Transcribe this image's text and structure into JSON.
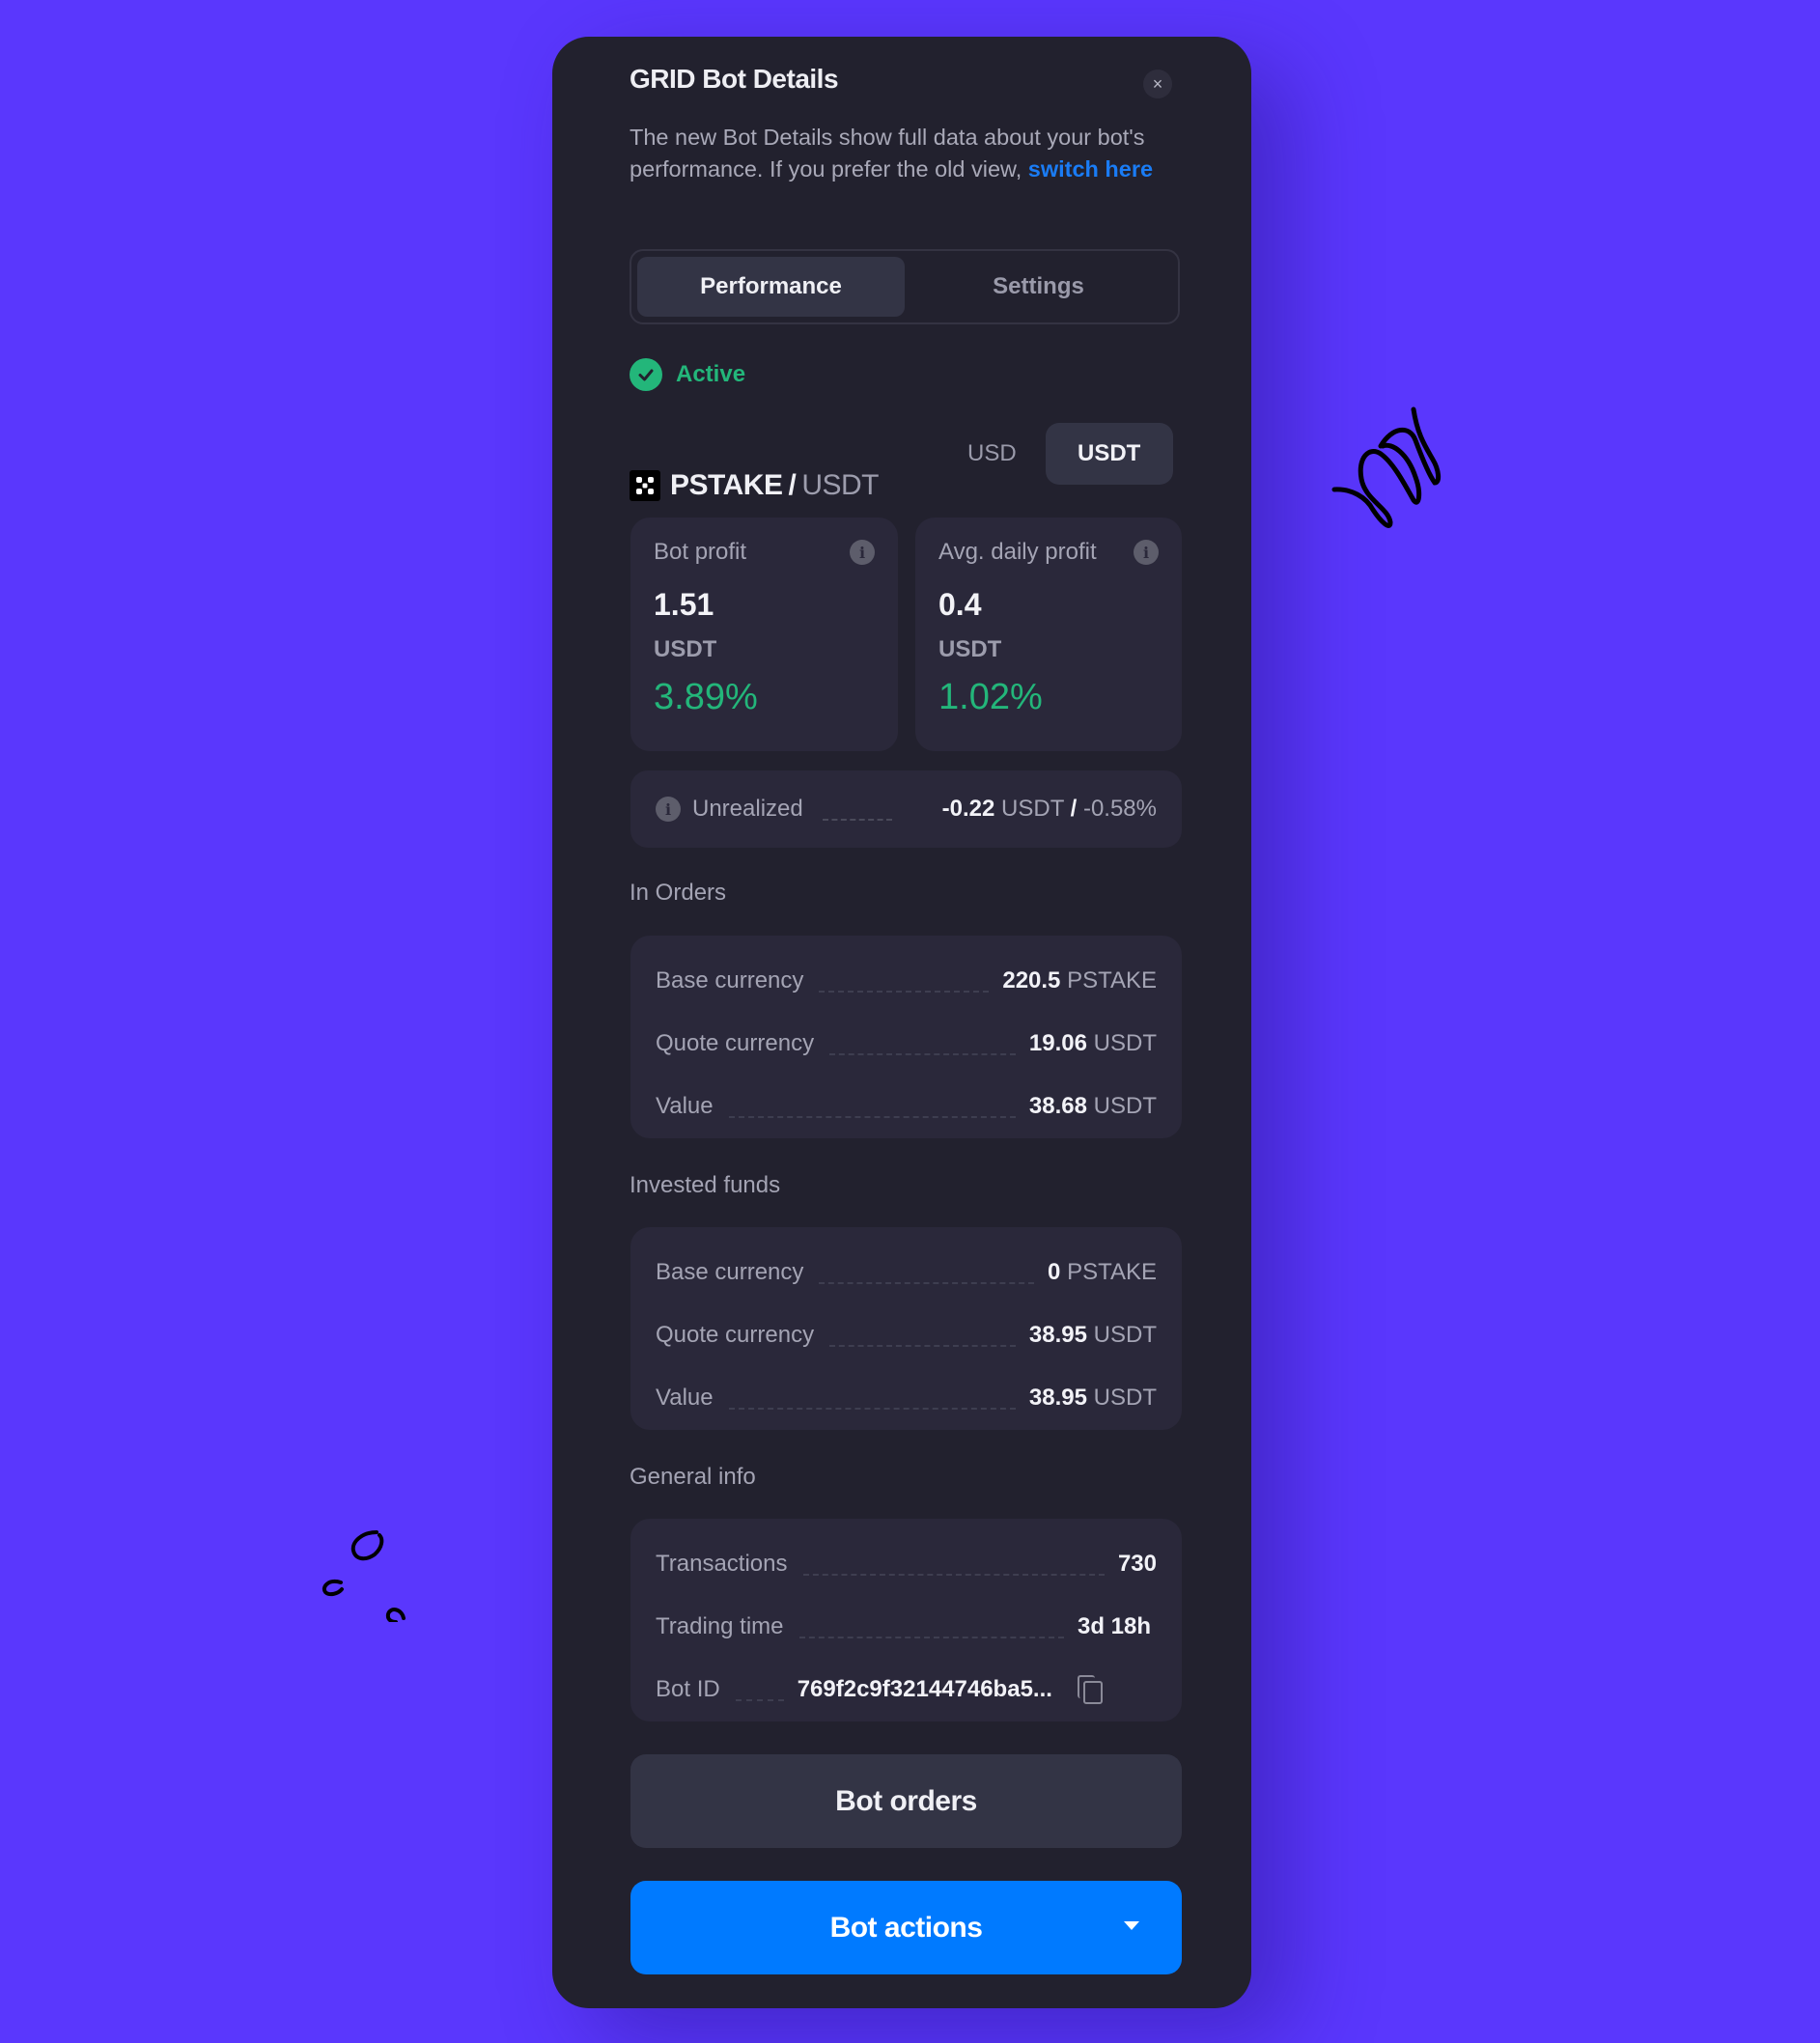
{
  "colors": {
    "background": "#5a37fd",
    "panel": "#22212e",
    "accent_green": "#23b67a",
    "link_blue": "#1a7cf5",
    "primary_button": "#007aff"
  },
  "dialog": {
    "title": "GRID Bot Details",
    "close_icon": "close-icon",
    "description": "The new Bot Details show full data about your bot's performance. If you prefer the old view, ",
    "switch_link": "switch here"
  },
  "tabs": [
    {
      "label": "Performance",
      "active": true
    },
    {
      "label": "Settings",
      "active": false
    }
  ],
  "status": {
    "label": "Active",
    "icon": "check-circle-icon"
  },
  "pair": {
    "base": "PSTAKE",
    "separator": "/",
    "quote": "USDT",
    "icon": "pstake-logo-icon"
  },
  "currency_toggle": [
    {
      "label": "USD",
      "active": false
    },
    {
      "label": "USDT",
      "active": true
    }
  ],
  "stats": {
    "bot_profit": {
      "label": "Bot profit",
      "value": "1.51",
      "unit": "USDT",
      "percent": "3.89%"
    },
    "avg_daily_profit": {
      "label": "Avg. daily profit",
      "value": "0.4",
      "unit": "USDT",
      "percent": "1.02%"
    }
  },
  "unrealized": {
    "label": "Unrealized",
    "value": "-0.22",
    "unit": "USDT",
    "separator": "/",
    "percent": "-0.58%"
  },
  "in_orders": {
    "title": "In Orders",
    "rows": [
      {
        "label": "Base currency",
        "value": "220.5",
        "unit": "PSTAKE"
      },
      {
        "label": "Quote currency",
        "value": "19.06",
        "unit": "USDT"
      },
      {
        "label": "Value",
        "value": "38.68",
        "unit": "USDT"
      }
    ]
  },
  "invested_funds": {
    "title": "Invested funds",
    "rows": [
      {
        "label": "Base currency",
        "value": "0",
        "unit": "PSTAKE"
      },
      {
        "label": "Quote currency",
        "value": "38.95",
        "unit": "USDT"
      },
      {
        "label": "Value",
        "value": "38.95",
        "unit": "USDT"
      }
    ]
  },
  "general_info": {
    "title": "General info",
    "rows": [
      {
        "label": "Transactions",
        "value": "730"
      },
      {
        "label": "Trading time",
        "value": "3d 18h"
      },
      {
        "label": "Bot ID",
        "value": "769f2c9f32144746ba5..."
      }
    ]
  },
  "buttons": {
    "bot_orders": "Bot orders",
    "bot_actions": "Bot actions"
  }
}
